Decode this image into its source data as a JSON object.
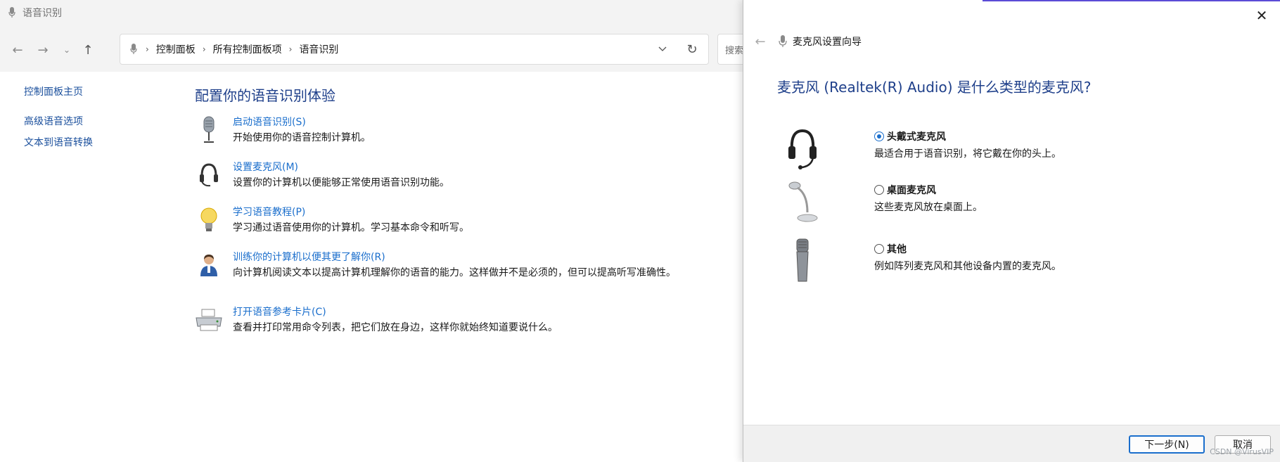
{
  "window": {
    "title": "语音识别"
  },
  "nav": {
    "breadcrumb": [
      "控制面板",
      "所有控制面板项",
      "语音识别"
    ],
    "search_placeholder": "搜索"
  },
  "sidebar": {
    "items": [
      {
        "label": "控制面板主页"
      },
      {
        "label": "高级语音选项"
      },
      {
        "label": "文本到语音转换"
      }
    ]
  },
  "content": {
    "title": "配置你的语音识别体验",
    "tasks": [
      {
        "icon": "microphone-icon",
        "link": "启动语音识别(S)",
        "desc": "开始使用你的语音控制计算机。"
      },
      {
        "icon": "headset-icon",
        "link": "设置麦克风(M)",
        "desc": "设置你的计算机以便能够正常使用语音识别功能。"
      },
      {
        "icon": "lightbulb-icon",
        "link": "学习语音教程(P)",
        "desc": "学习通过语音使用你的计算机。学习基本命令和听写。"
      },
      {
        "icon": "person-icon",
        "link": "训练你的计算机以便其更了解你(R)",
        "desc": "向计算机阅读文本以提高计算机理解你的语音的能力。这样做并不是必须的，但可以提高听写准确性。"
      },
      {
        "icon": "printer-icon",
        "link": "打开语音参考卡片(C)",
        "desc": "查看并打印常用命令列表，把它们放在身边，这样你就始终知道要说什么。"
      }
    ]
  },
  "wizard": {
    "title": "麦克风设置向导",
    "question": "麦克风 (Realtek(R) Audio) 是什么类型的麦克风?",
    "options": [
      {
        "icon": "headset-icon",
        "label": "头戴式麦克风",
        "desc": "最适合用于语音识别，将它戴在你的头上。",
        "checked": true
      },
      {
        "icon": "desk-microphone-icon",
        "label": "桌面麦克风",
        "desc": "这些麦克风放在桌面上。",
        "checked": false
      },
      {
        "icon": "handheld-microphone-icon",
        "label": "其他",
        "desc": "例如阵列麦克风和其他设备内置的麦克风。",
        "checked": false
      }
    ],
    "next_label": "下一步(N)",
    "cancel_label": "取消"
  },
  "watermark": "CSDN @VirusVIP",
  "colors": {
    "link": "#1a6ecc",
    "heading": "#1e3f8a",
    "accent": "#5b4bd6"
  }
}
